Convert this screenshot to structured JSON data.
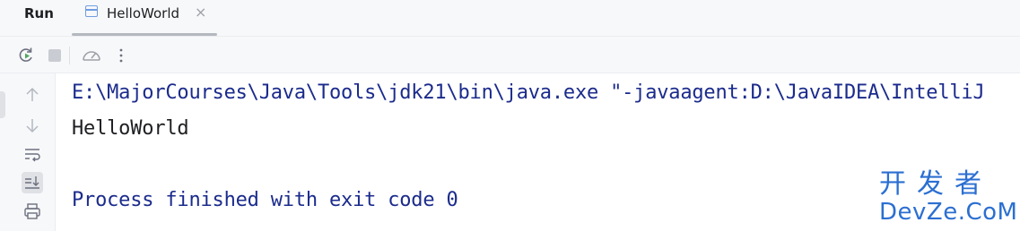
{
  "header": {
    "title": "Run",
    "tab": {
      "label": "HelloWorld",
      "close": "×"
    }
  },
  "toolbar": {
    "buttons": [
      "rerun-icon",
      "stop-icon",
      "profiler-icon",
      "more-icon"
    ]
  },
  "gutter": {
    "buttons": [
      "up-arrow-icon",
      "down-arrow-icon",
      "soft-wrap-icon",
      "scroll-to-end-icon",
      "print-icon"
    ],
    "active": "scroll-to-end-icon"
  },
  "console": {
    "command_line": "E:\\MajorCourses\\Java\\Tools\\jdk21\\bin\\java.exe \"-javaagent:D:\\JavaIDEA\\IntelliJ",
    "output": "HelloWorld",
    "exit_message": "Process finished with exit code 0"
  },
  "watermark": {
    "chinese": "开发者",
    "english": "DevZe.CoM"
  },
  "colors": {
    "console_blue": "#1b2b8c",
    "watermark_blue": "#2b6fd1",
    "panel_bg": "#f7f8fa"
  }
}
